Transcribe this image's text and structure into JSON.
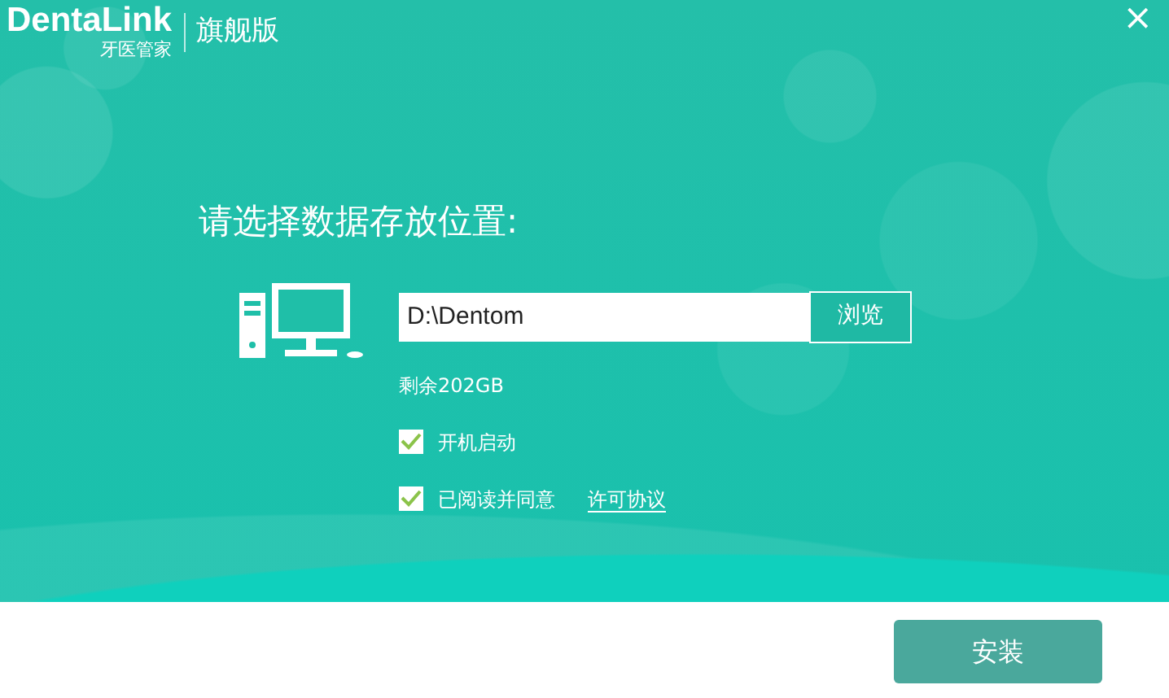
{
  "header": {
    "logo": "DentaLink",
    "logo_subtitle": "牙医管家",
    "edition": "旗舰版",
    "close": "×"
  },
  "heading": "请选择数据存放位置:",
  "path_field": {
    "value": "D:\\Dentom"
  },
  "browse_button": "浏览",
  "free_space": "剩余202GB",
  "options": [
    {
      "label": "开机启动",
      "checked": true
    },
    {
      "label": "已阅读并同意",
      "checked": true,
      "link": "许可协议"
    }
  ],
  "install_button": "安装"
}
